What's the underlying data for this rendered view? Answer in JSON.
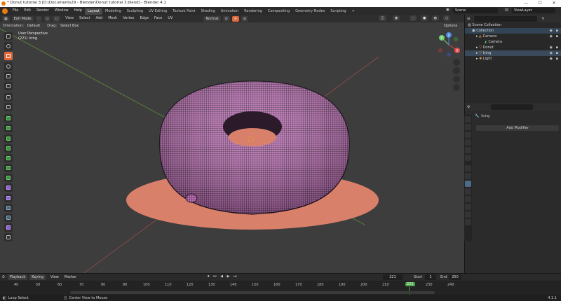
{
  "window": {
    "title": "* Donut tutorial 3 [D:\\Documents29 - Blender\\Donut tutorial 3.blend] - Blender 4.1",
    "controls": [
      "—",
      "☐",
      "✕"
    ]
  },
  "menu": [
    "File",
    "Edit",
    "Render",
    "Window",
    "Help"
  ],
  "workspaces": [
    "Layout",
    "Modeling",
    "Sculpting",
    "UV Editing",
    "Texture Paint",
    "Shading",
    "Animation",
    "Rendering",
    "Compositing",
    "Geometry Nodes",
    "Scripting",
    "+"
  ],
  "scene": {
    "name": "Scene",
    "viewlayer": "ViewLayer"
  },
  "viewport": {
    "mode": "Edit Mode",
    "menus": [
      "View",
      "Select",
      "Add",
      "Mesh",
      "Vertex",
      "Edge",
      "Face",
      "UV"
    ],
    "orientation_label": "Orientation:",
    "orientation_value": "Default",
    "drag_label": "Drag:",
    "drag_value": "Select Box",
    "transform": "Normal",
    "options": "Options",
    "overlay_title": "User Perspective",
    "overlay_object": "(221) Icing",
    "gizmo": {
      "x": "X",
      "y": "Y",
      "z": "Z"
    }
  },
  "outliner": {
    "search_placeholder": "",
    "rows": [
      {
        "label": "Scene Collection",
        "indent": 0
      },
      {
        "label": "Collection",
        "indent": 1
      },
      {
        "label": "Camera",
        "indent": 2
      },
      {
        "label": "Camera",
        "indent": 3
      },
      {
        "label": "Donut",
        "indent": 2
      },
      {
        "label": "Icing",
        "indent": 2
      },
      {
        "label": "Light",
        "indent": 2
      }
    ]
  },
  "properties": {
    "object_name": "Icing",
    "add_modifier": "Add Modifier"
  },
  "timeline": {
    "playback": "Playback",
    "keying": "Keying",
    "view": "View",
    "marker": "Marker",
    "current_frame": "221",
    "start_label": "Start",
    "start": "1",
    "end_label": "End",
    "end": "250",
    "ticks": [
      "40",
      "50",
      "60",
      "70",
      "80",
      "90",
      "100",
      "110",
      "120",
      "130",
      "140",
      "150",
      "160",
      "170",
      "180",
      "190",
      "200",
      "210",
      "221",
      "230",
      "240"
    ]
  },
  "status": {
    "left": "Loop Select",
    "middle": "Center View to Mouse",
    "version": "4.1.1"
  },
  "colors": {
    "accent": "#e0673a",
    "icing": "#c070b8",
    "dough": "#d9806a",
    "frame": "#4aa84a"
  }
}
